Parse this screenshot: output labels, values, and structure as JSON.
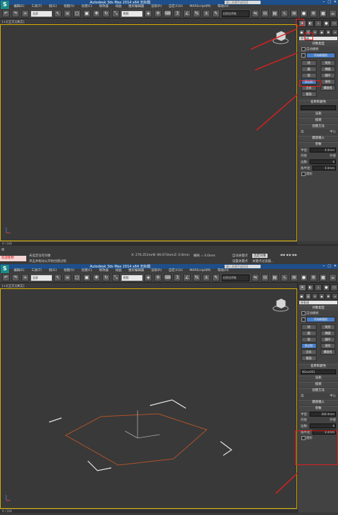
{
  "app": {
    "logo": "S",
    "title": "Autodesk 3ds Max 2014 x64  无标题",
    "search_placeholder": "键入关键字或短语",
    "window_controls": [
      "─",
      "□",
      "✕"
    ]
  },
  "menu": [
    "编辑(E)",
    "工具(T)",
    "组(G)",
    "视图(V)",
    "创建(C)",
    "修改器",
    "动画",
    "图形编辑器",
    "渲染(R)",
    "自定义(U)",
    "MAXScript(M)",
    "帮助(H)"
  ],
  "toolbar": {
    "filter_value": "全部",
    "view_value": "视图",
    "selection_set_placeholder": "创建选择集"
  },
  "viewport": {
    "label": "[+][正交][真实]"
  },
  "command_panel": {
    "category_dropdown": "样条线",
    "rollout_object_type": "对象类型",
    "autogrid": "自动栅格",
    "start_new_shape": "开始新图形",
    "buttons": [
      {
        "label": "线",
        "active": false
      },
      {
        "label": "矩形",
        "active": false
      },
      {
        "label": "圆",
        "active": false
      },
      {
        "label": "椭圆",
        "active": false
      },
      {
        "label": "弧",
        "active": false
      },
      {
        "label": "圆环",
        "active": false
      },
      {
        "label": "多边形",
        "active": true
      },
      {
        "label": "星形",
        "active": false
      },
      {
        "label": "文本",
        "active": false
      },
      {
        "label": "螺旋线",
        "active": false
      },
      {
        "label": "截面",
        "active": false
      }
    ],
    "rollout_name_color": "名称和颜色",
    "object_name": "NGon001",
    "rollout_rendering": "渲染",
    "rollout_interpolation": "插值",
    "rollout_creation_method": "创建方法",
    "edge": "边",
    "center": "中心",
    "rollout_keyboard": "键盘输入",
    "rollout_params": "参数",
    "radius_label": "半径:",
    "radius_value": "0.0mm",
    "radius_value_2": "380.0mm",
    "inscribed": "内接",
    "circumscribed": "外接",
    "sides_label": "边数:",
    "sides_value": "6",
    "corner_label": "角半径:",
    "corner_value": "0.0mm",
    "circular": "圆形"
  },
  "status": {
    "frame_counter": "0 / 100",
    "selection_msg_1": "未选定任何对象",
    "selection_msg_2": "单击并拖动以开始创建过程",
    "welcome": "欢迎使用",
    "coord_x": "X: 276.351mm",
    "coord_y": "Y: 89.073mm",
    "coord_z": "Z: 0.0mm",
    "grid": "栅格 = 0.0mm",
    "auto_key": "自动关键点",
    "set_key": "设置关键点",
    "selected_obj": "选定对象",
    "key_filters": "关键点过滤器...",
    "add_time_tag": "添加时间标记"
  },
  "colors": {
    "title_bar": "#1e4f8a",
    "annotation": "#e02020",
    "polygon_stroke": "#b0532a",
    "active_button": "#4a7fc8"
  }
}
